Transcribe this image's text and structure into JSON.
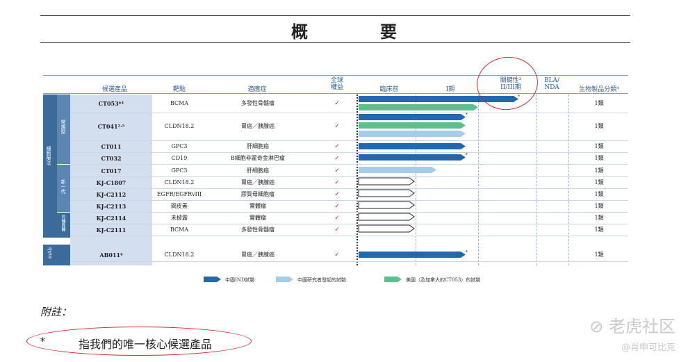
{
  "title": "概　要",
  "headers": {
    "product": "候選產品",
    "target": "靶點",
    "indication": "適應症",
    "global_rights": "全球\n權益",
    "preclinical": "臨床前",
    "phase1": "I期",
    "pivotal": "關鍵性³\nII/III期",
    "bla": "BLA/\nNDA",
    "category": "生物製品分類⁴"
  },
  "groups": {
    "cell_therapy": "細胞療法",
    "conventional": "常規型",
    "next_gen": "新一代",
    "allogeneic": "同種異體",
    "mab": "mAb"
  },
  "rows": [
    {
      "product": "CT053*¹",
      "target": "BCMA",
      "indication": "多發性骨髓瘤",
      "check": "✓",
      "category": "1類"
    },
    {
      "product": "CT041²·⁵",
      "target": "CLDN18.2",
      "indication": "胃癌／胰腺癌",
      "check": "✓",
      "category": "1類"
    },
    {
      "product": "CT011",
      "target": "GPC3",
      "indication": "肝細胞癌",
      "check": "✓",
      "category": "1類"
    },
    {
      "product": "CT032",
      "target": "CD19",
      "indication": "B細胞非霍奇金淋巴瘤",
      "check": "✓",
      "category": "1類"
    },
    {
      "product": "CT017",
      "target": "GPC3",
      "indication": "肝細胞癌",
      "check": "✓",
      "category": "1類"
    },
    {
      "product": "KJ-C1807",
      "target": "CLDN18.2",
      "indication": "胃癌／胰腺癌",
      "check": "✓",
      "category": "1類"
    },
    {
      "product": "KJ-C2112",
      "target": "EGFR/EGFRvIII",
      "indication": "膠質母細胞瘤",
      "check": "✓",
      "category": "1類"
    },
    {
      "product": "KJ-C2113",
      "target": "間皮素",
      "indication": "實體瘤",
      "check": "✓",
      "category": "1類"
    },
    {
      "product": "KJ-C2114",
      "target": "未披露",
      "indication": "實體瘤",
      "check": "✓",
      "category": "1類"
    },
    {
      "product": "KJ-C2111",
      "target": "BCMA",
      "indication": "多發性骨髓瘤",
      "check": "✓",
      "category": "1類"
    },
    {
      "product": "AB011⁶",
      "target": "CLDN18.2",
      "indication": "胃癌／胰腺癌",
      "check": "✓",
      "category": "1類"
    }
  ],
  "legend": {
    "ind": "中國IND試驗",
    "iit": "中國研究者發起的試驗",
    "us": "美國（及加拿大的CT053）的試驗"
  },
  "notes": {
    "heading": "附註：",
    "star": "*",
    "core": "指我們的唯一核心候選產品"
  },
  "watermark": {
    "brand": "老虎社区",
    "user": "@肖申可比克"
  },
  "colors": {
    "ind": "#2367ac",
    "iit": "#a3cdea",
    "us": "#5cbf8e"
  }
}
